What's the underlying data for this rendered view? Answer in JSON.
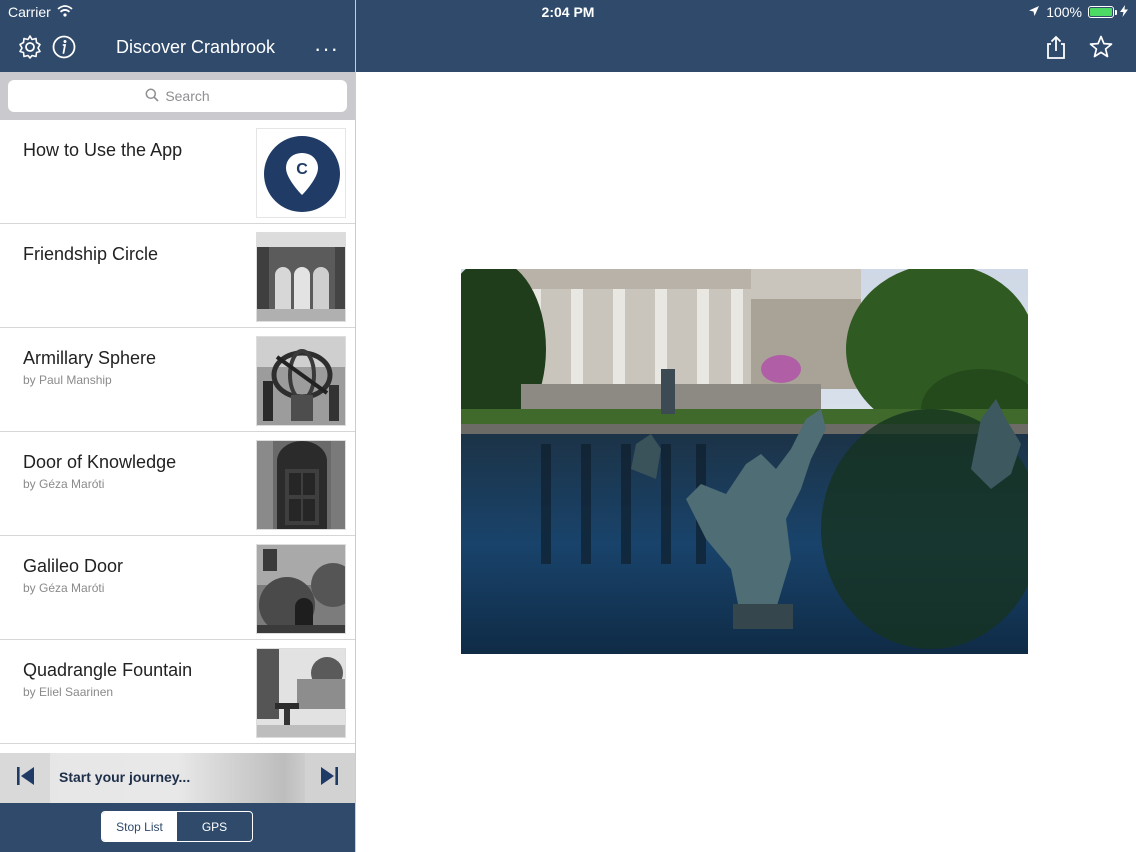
{
  "status_bar": {
    "carrier": "Carrier",
    "time": "2:04 PM",
    "battery": "100%"
  },
  "sidebar_nav": {
    "title": "Discover Cranbrook",
    "more": "···"
  },
  "search": {
    "placeholder": "Search"
  },
  "stops": [
    {
      "title": "How to Use the App",
      "subtitle": ""
    },
    {
      "title": "Friendship Circle",
      "subtitle": ""
    },
    {
      "title": "Armillary Sphere",
      "subtitle": "by Paul Manship"
    },
    {
      "title": "Door of Knowledge",
      "subtitle": "by Géza Maróti"
    },
    {
      "title": "Galileo Door",
      "subtitle": "by Géza Maróti"
    },
    {
      "title": "Quadrangle Fountain",
      "subtitle": "by Eliel Saarinen"
    }
  ],
  "journey": {
    "label": "Start your journey..."
  },
  "segmented": {
    "left": "Stop List",
    "right": "GPS",
    "selected": "Stop List"
  },
  "colors": {
    "nav_bg": "#2f4a6b",
    "logo_circle": "#1f3b66",
    "battery_fill": "#4cd964"
  },
  "icons": {
    "settings": "gear-icon",
    "info": "info-icon",
    "share": "share-icon",
    "favorite": "star-icon",
    "search": "search-icon"
  }
}
